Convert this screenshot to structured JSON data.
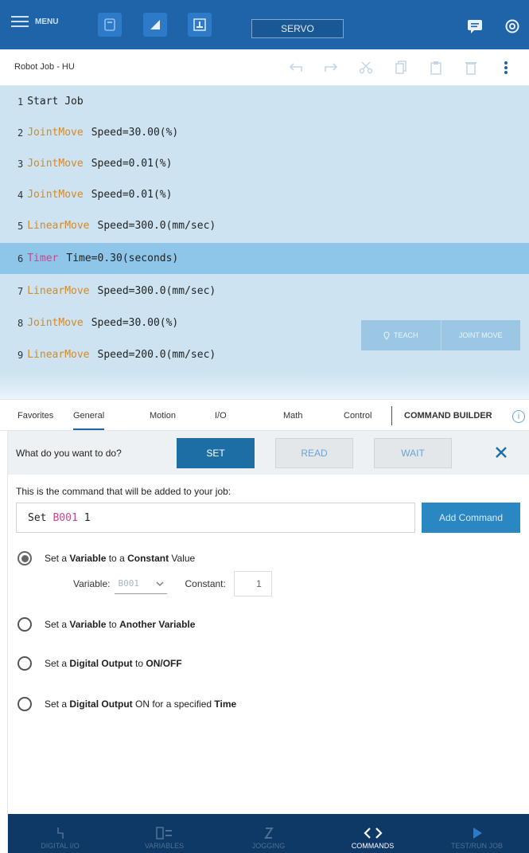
{
  "topbar": {
    "menu_label": "MENU",
    "servo_label": "SERVO",
    "icons": [
      "job-icon",
      "teach-pendant-icon",
      "user-icon"
    ],
    "accent": "#1f64a8"
  },
  "job": {
    "title": "Robot Job - HU",
    "tools": [
      "undo-icon",
      "redo-icon",
      "cut-icon",
      "copy-icon",
      "paste-icon",
      "delete-icon",
      "more-vertical-icon"
    ]
  },
  "program": {
    "lines": [
      {
        "num": "1",
        "kw": "",
        "rest": "Start Job"
      },
      {
        "num": "2",
        "kw": "JointMove",
        "rest": "Speed=30.00(%)"
      },
      {
        "num": "3",
        "kw": "JointMove",
        "rest": "Speed=0.01(%)"
      },
      {
        "num": "4",
        "kw": "JointMove",
        "rest": "Speed=0.01(%)"
      },
      {
        "num": "5",
        "kw": "LinearMove",
        "rest": "Speed=300.0(mm/sec)"
      },
      {
        "num": "6",
        "kw": "Timer",
        "rest": "Time=0.30(seconds)"
      },
      {
        "num": "7",
        "kw": "LinearMove",
        "rest": "Speed=300.0(mm/sec)"
      },
      {
        "num": "8",
        "kw": "JointMove",
        "rest": "Speed=30.00(%)"
      },
      {
        "num": "9",
        "kw": "LinearMove",
        "rest": "Speed=200.0(mm/sec)"
      }
    ],
    "selected_line": "6",
    "teach_label": "TEACH",
    "jointmove_label": "JOINT MOVE"
  },
  "tabs": {
    "items": [
      "Favorites",
      "General",
      "Motion",
      "I/O",
      "Math",
      "Control"
    ],
    "active": "General",
    "builder_label": "COMMAND BUILDER",
    "info": "i"
  },
  "question": {
    "text": "What do you want to do?",
    "set": "SET",
    "read": "READ",
    "wait": "WAIT"
  },
  "builder": {
    "caption": "This is the command that will be added to your job:",
    "cmd_keyword": "Set",
    "cmd_var": "B001",
    "cmd_value": "1",
    "add_label": "Add Command",
    "options": [
      {
        "parts": [
          "Set a ",
          "Variable",
          " to a ",
          "Constant",
          " Value"
        ],
        "checked": true
      },
      {
        "parts": [
          "Set a ",
          "Variable",
          " to ",
          "Another Variable",
          ""
        ],
        "checked": false
      },
      {
        "parts": [
          "Set a ",
          "Digital Output",
          " to ",
          "ON/OFF",
          ""
        ],
        "checked": false
      },
      {
        "parts": [
          "Set a ",
          "Digital Output",
          " ON for a specified ",
          "Time",
          ""
        ],
        "checked": false
      }
    ],
    "variable_label": "Variable:",
    "variable_value": "B001",
    "constant_label": "Constant:",
    "constant_value": "1"
  },
  "bottomnav": {
    "items": [
      "DIGITAL I/O",
      "VARIABLES",
      "JOGGING",
      "COMMANDS",
      "TEST/RUN JOB"
    ],
    "active": "COMMANDS"
  }
}
